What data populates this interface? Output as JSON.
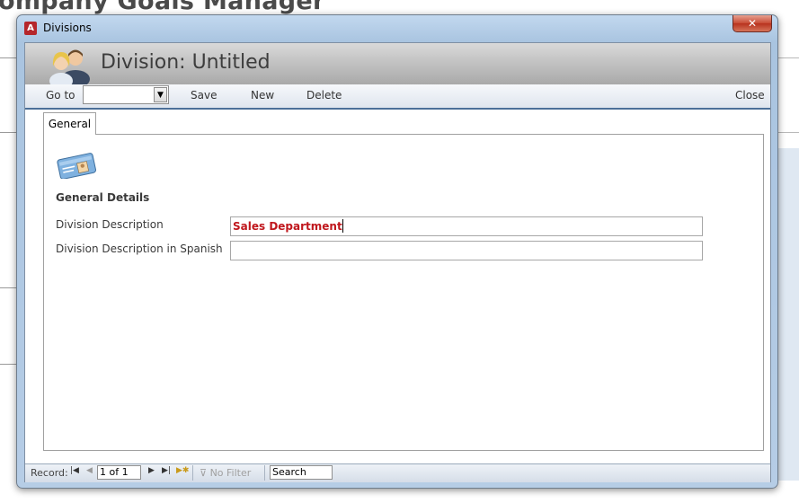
{
  "background_app": {
    "title": "ompany Goals Manager"
  },
  "window": {
    "title": "Divisions",
    "app_icon_glyph": "A",
    "close_glyph": "✕"
  },
  "form": {
    "header_title": "Division: Untitled",
    "toolbar": {
      "goto_label": "Go to",
      "goto_value": "",
      "save_label": "Save",
      "new_label": "New",
      "delete_label": "Delete",
      "close_label": "Close"
    },
    "tabs": [
      {
        "label": "General",
        "active": true
      }
    ],
    "section_heading": "General Details",
    "fields": [
      {
        "label": "Division Description",
        "value": "Sales Department",
        "focused": true
      },
      {
        "label": "Division Description in Spanish",
        "value": ""
      }
    ]
  },
  "navigation": {
    "record_label": "Record:",
    "record_position": "1 of 1",
    "filter_label": "No Filter",
    "search_placeholder": "Search",
    "icons": [
      "first-record-icon",
      "previous-record-icon",
      "next-record-icon",
      "last-record-icon",
      "new-record-icon",
      "filter-icon"
    ]
  },
  "colors": {
    "field_value_text": "#c0171d",
    "toolbar_border": "#4b6f98",
    "window_frame": "#b6cde6",
    "close_button": "#c74a33"
  }
}
